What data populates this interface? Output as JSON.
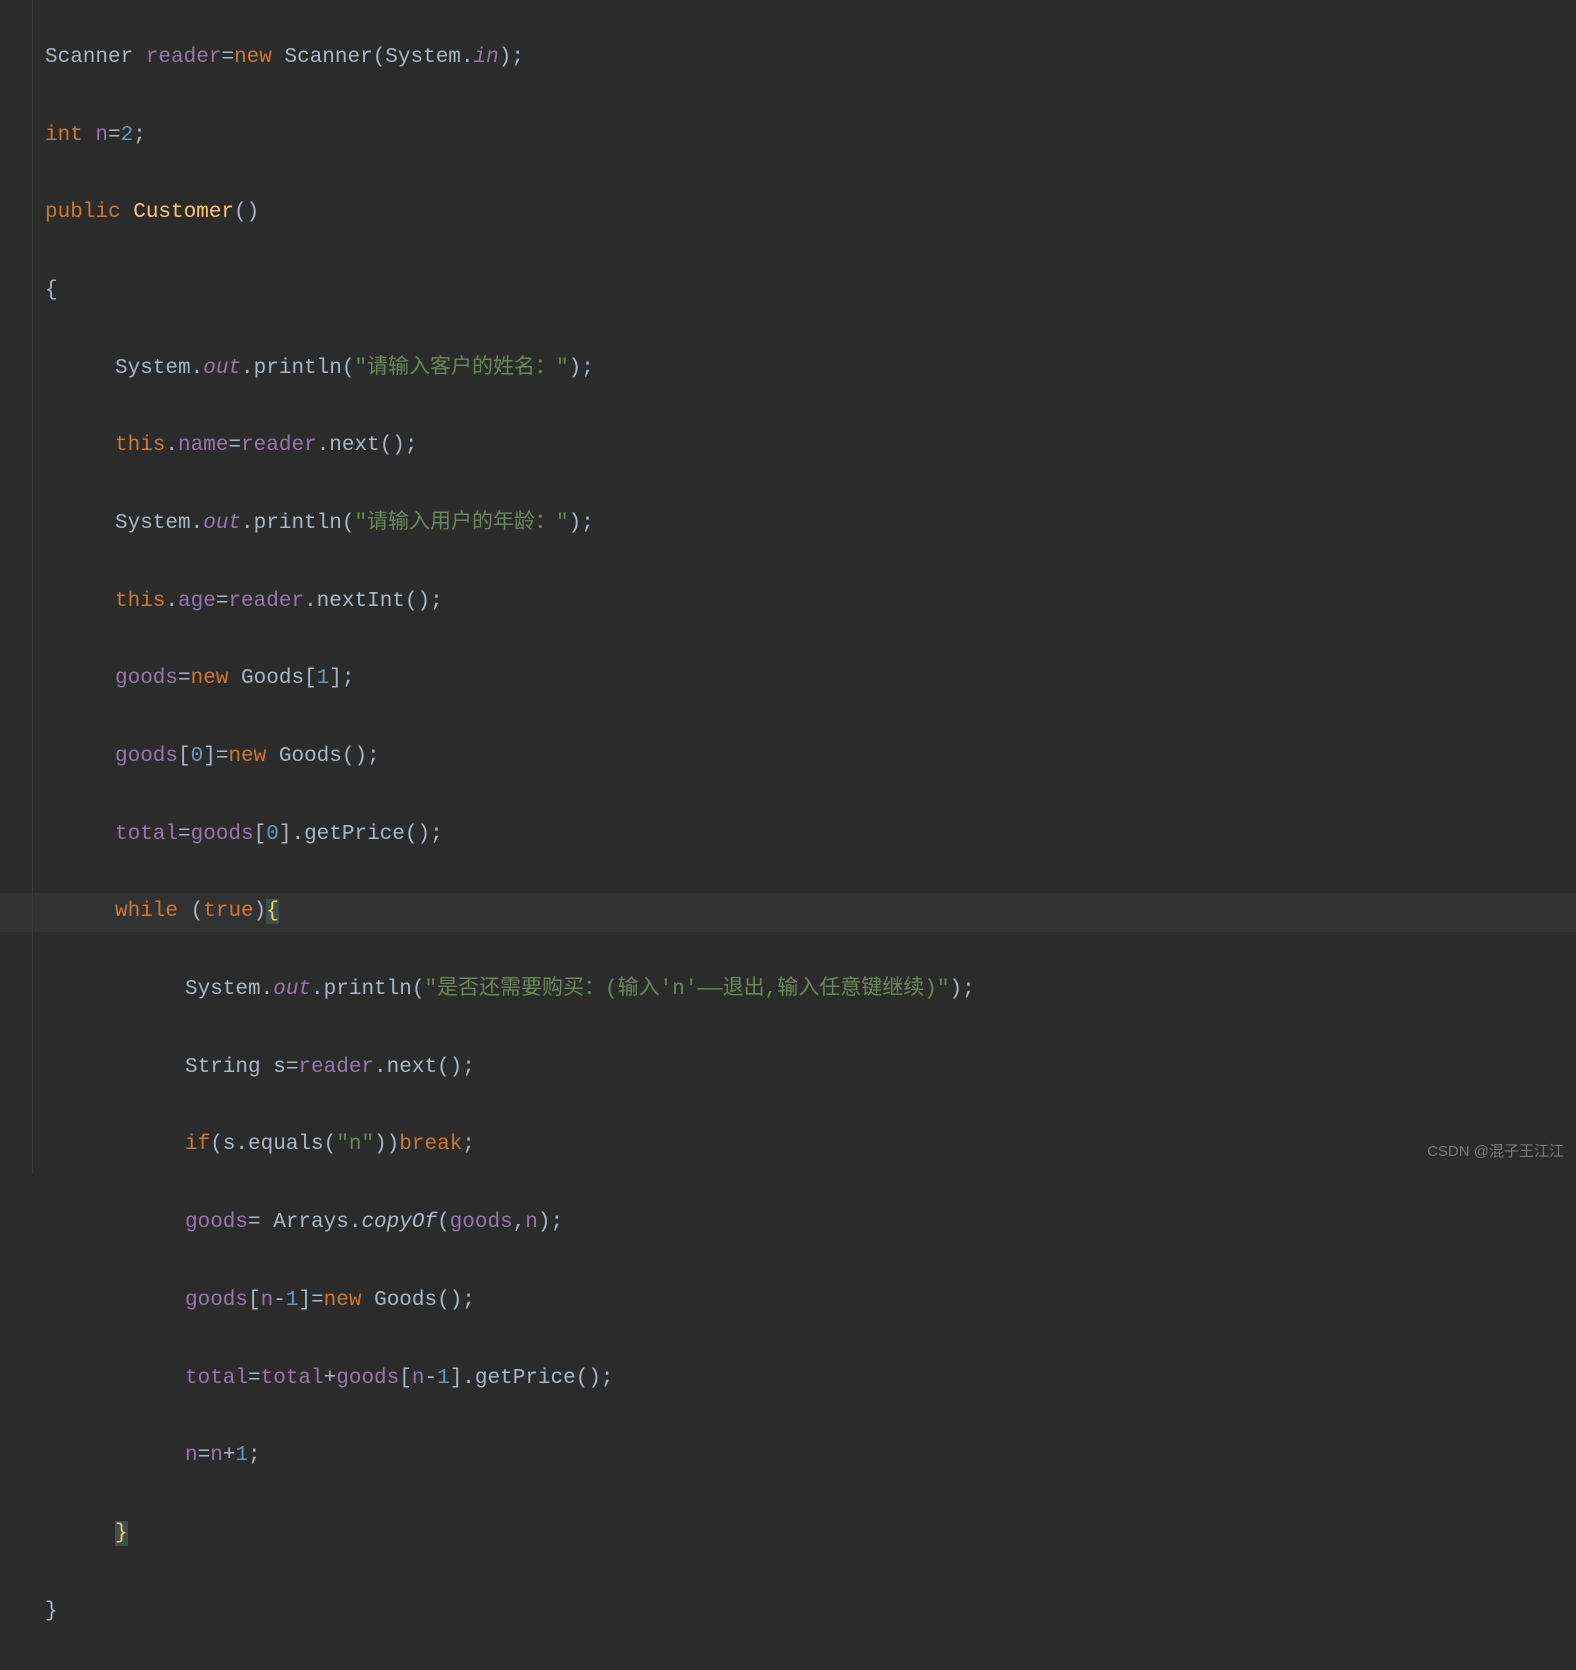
{
  "code": {
    "l1": {
      "t1": "Scanner ",
      "t2": "reader",
      "t3": "=",
      "t4": "new ",
      "t5": "Scanner(System.",
      "t6": "in",
      "t7": ");"
    },
    "l2": {
      "t1": "int ",
      "t2": "n",
      "t3": "=",
      "t4": "2",
      "t5": ";"
    },
    "l3": {
      "t1": "public ",
      "t2": "Customer",
      "t3": "()"
    },
    "l4": {
      "t1": "{"
    },
    "l5": {
      "t1": "System.",
      "t2": "out",
      "t3": ".println(",
      "t4": "\"请输入客户的姓名：\"",
      "t5": ");"
    },
    "l6": {
      "t1": "this",
      "t2": ".",
      "t3": "name",
      "t4": "=",
      "t5": "reader",
      "t6": ".next();"
    },
    "l7": {
      "t1": "System.",
      "t2": "out",
      "t3": ".println(",
      "t4": "\"请输入用户的年龄：\"",
      "t5": ");"
    },
    "l8": {
      "t1": "this",
      "t2": ".",
      "t3": "age",
      "t4": "=",
      "t5": "reader",
      "t6": ".nextInt();"
    },
    "l9": {
      "t1": "goods",
      "t2": "=",
      "t3": "new ",
      "t4": "Goods[",
      "t5": "1",
      "t6": "];"
    },
    "l10": {
      "t1": "goods",
      "t2": "[",
      "t3": "0",
      "t4": "]=",
      "t5": "new ",
      "t6": "Goods();"
    },
    "l11": {
      "t1": "total",
      "t2": "=",
      "t3": "goods",
      "t4": "[",
      "t5": "0",
      "t6": "].getPrice();"
    },
    "l12": {
      "t1": "while ",
      "t2": "(",
      "t3": "true",
      "t4": ")",
      "t5": "{"
    },
    "l13": {
      "t1": "System.",
      "t2": "out",
      "t3": ".println(",
      "t4": "\"是否还需要购买：(输入'n'——退出,输入任意键继续)\"",
      "t5": ");"
    },
    "l14": {
      "t1": "String s=",
      "t2": "reader",
      "t3": ".next();"
    },
    "l15": {
      "t1": "if",
      "t2": "(s.equals(",
      "t3": "\"n\"",
      "t4": "))",
      "t5": "break",
      "t6": ";"
    },
    "l16": {
      "t1": "goods",
      "t2": "= Arrays.",
      "t3": "copyOf",
      "t4": "(",
      "t5": "goods",
      "t6": ",",
      "t7": "n",
      "t8": ");"
    },
    "l17": {
      "t1": "goods",
      "t2": "[",
      "t3": "n",
      "t4": "-",
      "t5": "1",
      "t6": "]=",
      "t7": "new ",
      "t8": "Goods();"
    },
    "l18": {
      "t1": "total",
      "t2": "=",
      "t3": "total",
      "t4": "+",
      "t5": "goods",
      "t6": "[",
      "t7": "n",
      "t8": "-",
      "t9": "1",
      "t10": "].getPrice();"
    },
    "l19": {
      "t1": "n",
      "t2": "=",
      "t3": "n",
      "t4": "+",
      "t5": "1",
      "t6": ";"
    },
    "l20": {
      "t1": "}"
    },
    "l21": {
      "t1": "}"
    }
  },
  "watermark": "CSDN @混子王江江"
}
